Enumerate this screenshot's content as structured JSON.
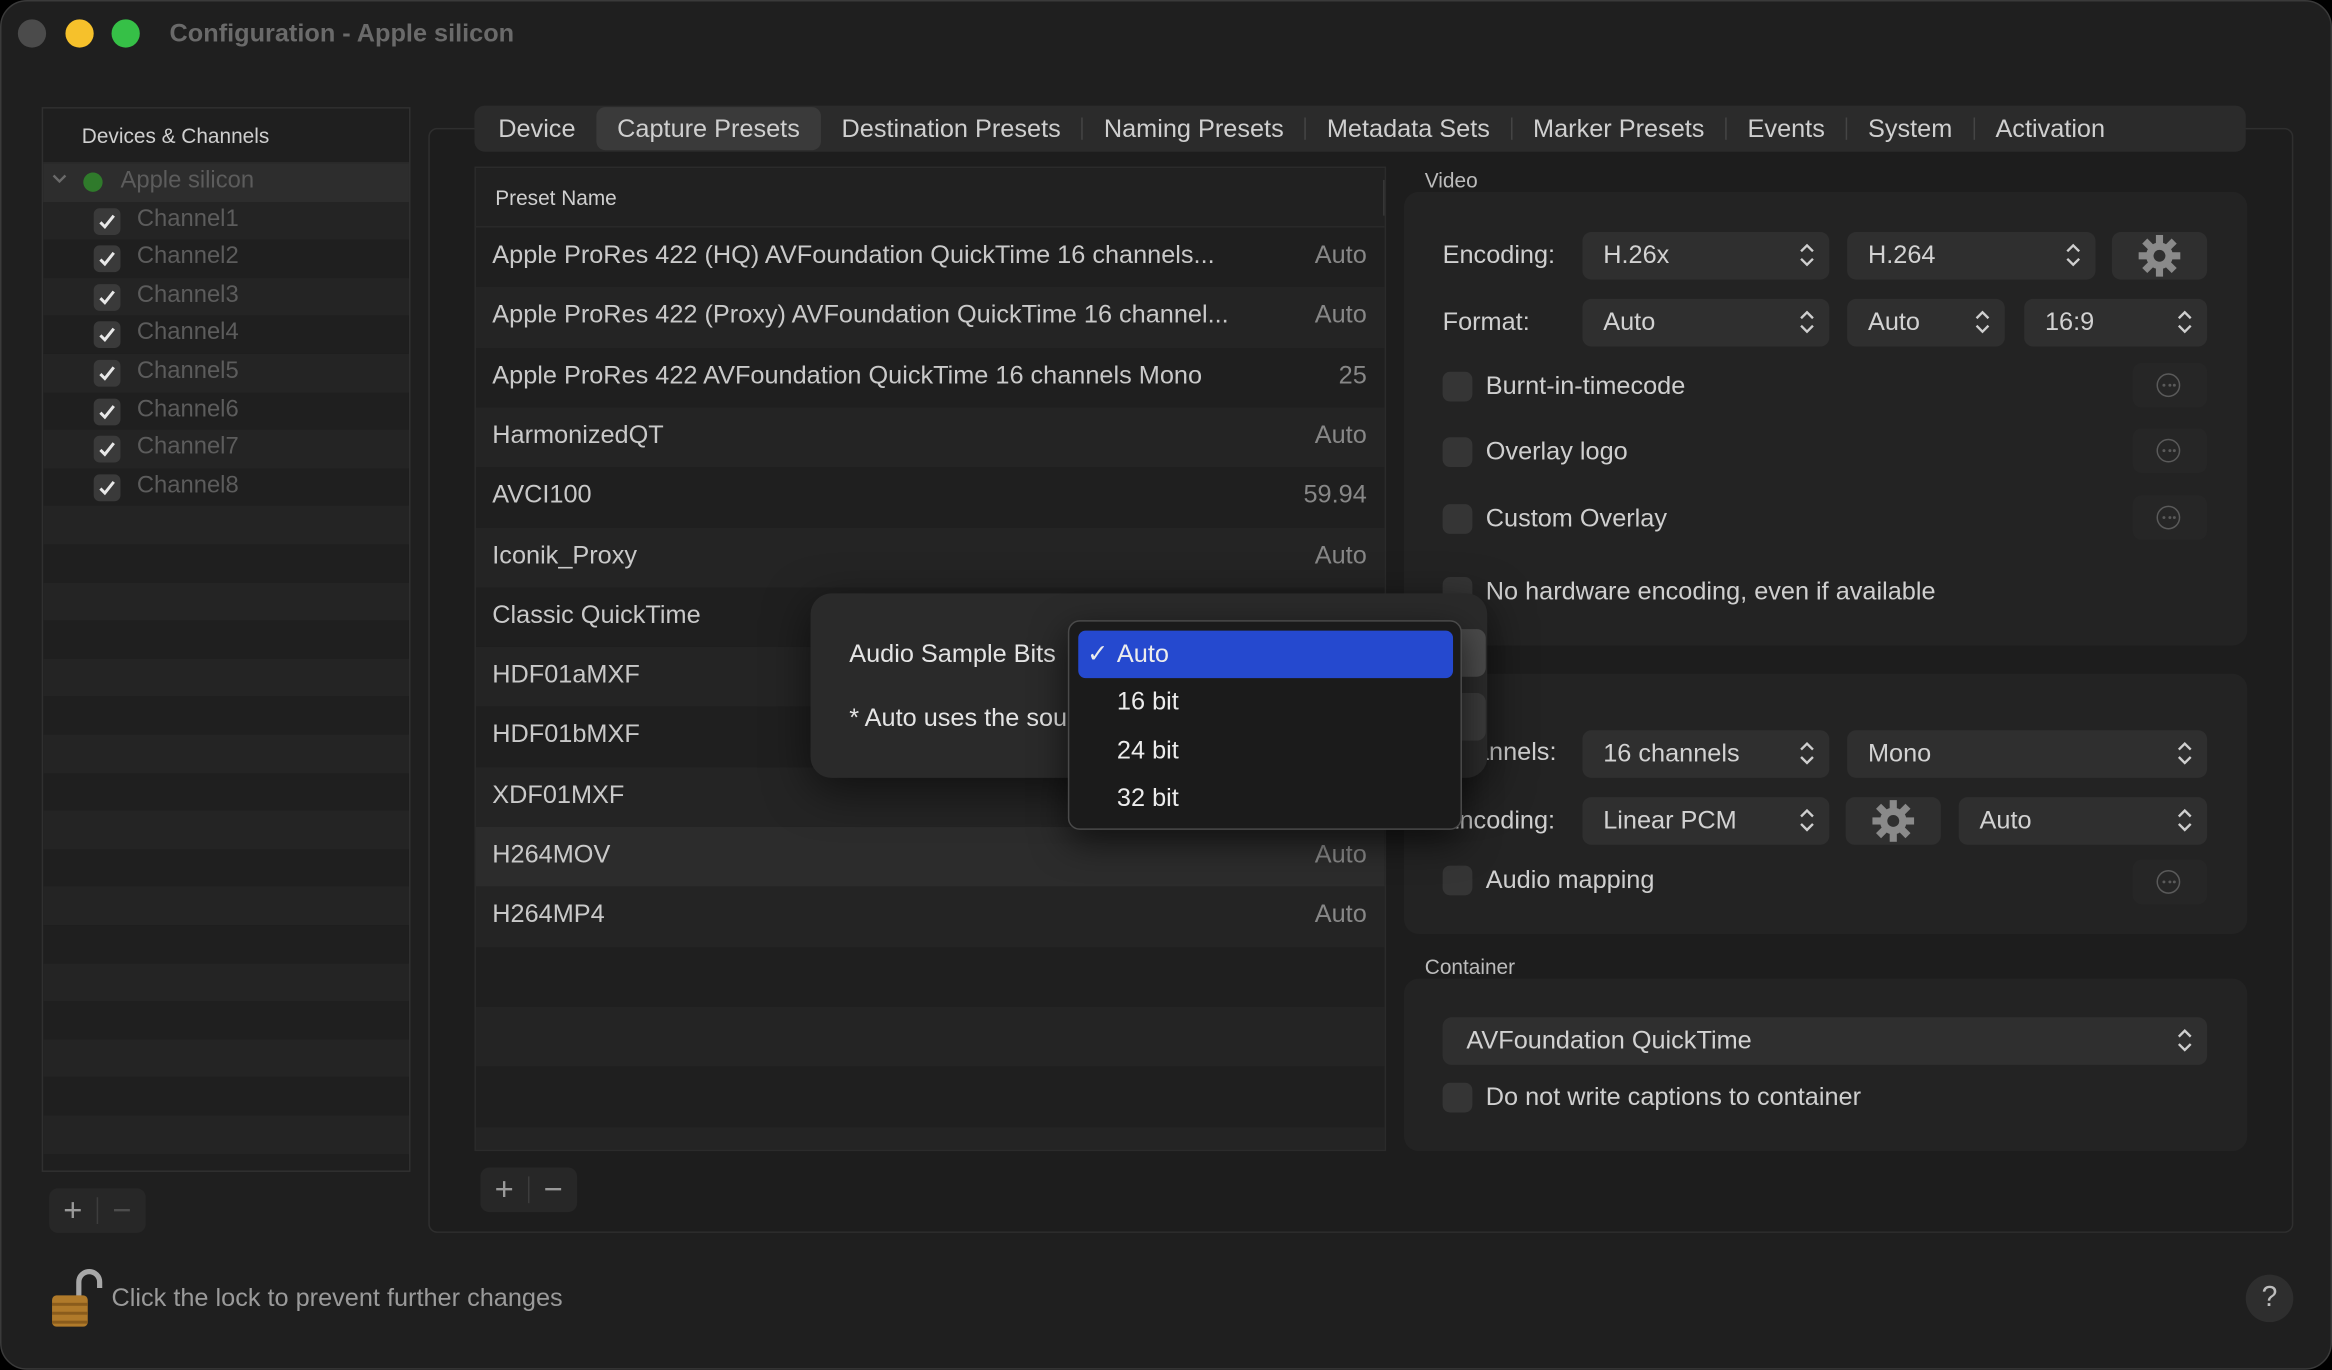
{
  "window": {
    "title": "Configuration - Apple silicon"
  },
  "sidebar": {
    "header": "Devices & Channels",
    "device": "Apple silicon",
    "channels": [
      "Channel1",
      "Channel2",
      "Channel3",
      "Channel4",
      "Channel5",
      "Channel6",
      "Channel7",
      "Channel8"
    ],
    "add": "+",
    "remove": "−"
  },
  "tabs": [
    "Device",
    "Capture Presets",
    "Destination Presets",
    "Naming Presets",
    "Metadata Sets",
    "Marker Presets",
    "Events",
    "System",
    "Activation"
  ],
  "selected_tab": "Capture Presets",
  "presets": {
    "column_header": "Preset Name",
    "rows": [
      {
        "name": "Apple ProRes 422 (HQ) AVFoundation QuickTime 16 channels...",
        "value": "Auto"
      },
      {
        "name": "Apple ProRes 422 (Proxy) AVFoundation QuickTime 16 channel...",
        "value": "Auto"
      },
      {
        "name": "Apple ProRes 422 AVFoundation QuickTime 16 channels Mono",
        "value": "25"
      },
      {
        "name": "HarmonizedQT",
        "value": "Auto"
      },
      {
        "name": "AVCI100",
        "value": "59.94"
      },
      {
        "name": "Iconik_Proxy",
        "value": "Auto"
      },
      {
        "name": "Classic QuickTime",
        "value": ""
      },
      {
        "name": "HDF01aMXF",
        "value": ""
      },
      {
        "name": "HDF01bMXF",
        "value": ""
      },
      {
        "name": "XDF01MXF",
        "value": ""
      },
      {
        "name": "H264MOV",
        "value": "Auto"
      },
      {
        "name": "H264MP4",
        "value": "Auto"
      }
    ],
    "add": "+",
    "remove": "−"
  },
  "video": {
    "title": "Video",
    "encoding_label": "Encoding:",
    "encoding_family": "H.26x",
    "encoding_codec": "H.264",
    "format_label": "Format:",
    "format_1": "Auto",
    "format_2": "Auto",
    "format_3": "16:9",
    "burnt_in": "Burnt-in-timecode",
    "overlay_logo": "Overlay logo",
    "custom_overlay": "Custom Overlay",
    "no_hw": "No hardware encoding, even if available"
  },
  "audio": {
    "channels_label": "Channels:",
    "channels_value": "16 channels",
    "channels_mode": "Mono",
    "encoding_label": "Encoding:",
    "encoding_value": "Linear PCM",
    "encoding_rate": "Auto",
    "mapping": "Audio mapping"
  },
  "container": {
    "title": "Container",
    "value": "AVFoundation QuickTime",
    "no_captions": "Do not write captions to container"
  },
  "sheet": {
    "label": "Audio Sample Bits",
    "note": "* Auto uses the source"
  },
  "menu": {
    "items": [
      "Auto",
      "16 bit",
      "24 bit",
      "32 bit"
    ],
    "checkmark": "✓"
  },
  "footer": {
    "lock_text": "Click the lock to prevent further changes",
    "help": "?"
  },
  "colors": {
    "accent": "#2549cf",
    "green_dot": "#2f7a2b",
    "yellow": "#f6c12b",
    "green": "#36c047"
  }
}
